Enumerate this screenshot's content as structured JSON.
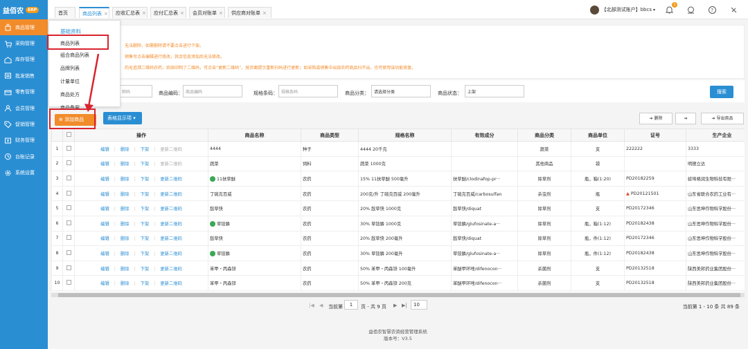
{
  "brand": {
    "name": "益佰农",
    "badge": "ERP"
  },
  "sidebar": {
    "items": [
      {
        "label": "商品管理",
        "icon": "bag-icon",
        "active": true
      },
      {
        "label": "采购管理",
        "icon": "cart-icon"
      },
      {
        "label": "库存管理",
        "icon": "warehouse-icon"
      },
      {
        "label": "批发销售",
        "icon": "wholesale-icon"
      },
      {
        "label": "零售管理",
        "icon": "retail-icon"
      },
      {
        "label": "会员管理",
        "icon": "member-icon"
      },
      {
        "label": "促销管理",
        "icon": "tag-icon"
      },
      {
        "label": "财务管理",
        "icon": "finance-icon"
      },
      {
        "label": "台账记录",
        "icon": "ledger-icon"
      },
      {
        "label": "系统设置",
        "icon": "settings-icon"
      }
    ]
  },
  "tabs": [
    {
      "label": "首页"
    },
    {
      "label": "商品列表",
      "active": true
    },
    {
      "label": "应收汇总表"
    },
    {
      "label": "应付汇总表"
    },
    {
      "label": "会员对账单"
    },
    {
      "label": "供应商对账单"
    }
  ],
  "user": {
    "name": "【北部测试账户】bbcs",
    "notification_count": "1"
  },
  "dropdown": {
    "header": "基础资料",
    "items": [
      "商品列表",
      "组合商品列表",
      "品牌列表",
      "计量单位",
      "商品处方",
      "商品备案"
    ]
  },
  "notices": [
    "无法删除，如需删除请不要点击进行下架。",
    "销售可点击编辑进行修改，其余信息添加后无法修改。",
    "的无追溯二维码农药，后续印制了二维码，可点击“更新二维码”，按页面提示重新扫码进行更新；如采购或销售中出现农药商品扫不出，也可使用该功能修复。"
  ],
  "filters": {
    "name_placeholder": "称码",
    "code_label": "商品编码：",
    "code_placeholder": "商品编码",
    "barcode_label": "规格条码：",
    "barcode_placeholder": "规格条码",
    "category_label": "商品分类：",
    "category_value": "请选择分类",
    "status_label": "商品状态：",
    "status_value": "上架",
    "search": "搜索"
  },
  "toolbar": {
    "add": "添加商品",
    "display": "表格显示项",
    "delete": "删除",
    "export": "导出商品"
  },
  "table": {
    "headers": [
      "操作",
      "商品名称",
      "商品类型",
      "规格名称",
      "有效成分",
      "商品分类",
      "商品单位",
      "证号",
      "生产企业"
    ],
    "actions": {
      "edit": "编辑",
      "delete": "删除",
      "shelf": "下架",
      "qr": "更新二维码"
    },
    "rows": [
      {
        "no": "1",
        "name": "4444",
        "type": "种子",
        "spec": "4444 20千克",
        "ingredient": "",
        "category": "蔬菜",
        "unit": "支",
        "cert": "222222",
        "maker": "3333",
        "qr_active": false
      },
      {
        "no": "2",
        "name": "蔬菜",
        "type": "饲料",
        "spec": "蔬菜 1000克",
        "ingredient": "",
        "category": "其他商品",
        "unit": "袋",
        "cert": "",
        "maker": "明德立达",
        "qr_active": false
      },
      {
        "no": "3",
        "name": "11扶草醚",
        "type": "农药",
        "spec": "15% 11扶草醚 500毫升",
        "ingredient": "扶草醚/clodinafop-pr···",
        "category": "除草剂",
        "unit": "瓶，箱(1:20)",
        "cert": "PD20182259",
        "maker": "蚌埠格润生物科技有限···",
        "qr_active": true,
        "badge": true
      },
      {
        "no": "4",
        "name": "丁硫克百威",
        "type": "农药",
        "spec": "200克/升 丁硫克百威 200毫升",
        "ingredient": "丁硫克百威/carbosulfan",
        "category": "杀虫剂",
        "unit": "瓶",
        "cert": "PD20121501",
        "maker": "山东省联合农药工业有···",
        "qr_active": true,
        "warn": true
      },
      {
        "no": "5",
        "name": "敌草快",
        "type": "农药",
        "spec": "20% 敌草快 1000克",
        "ingredient": "敌草快/diquat",
        "category": "除草剂",
        "unit": "支",
        "cert": "PD20172346",
        "maker": "山东思坤作物科学股份···",
        "qr_active": true
      },
      {
        "no": "6",
        "name": "草铵膦",
        "type": "农药",
        "spec": "30% 草铵膦 1000克",
        "ingredient": "草铵膦/glufosinate-a···",
        "category": "除草剂",
        "unit": "瓶，箱(1:12)",
        "cert": "PD20182438",
        "maker": "山东思坤作物科学股份···",
        "qr_active": true,
        "badge": true
      },
      {
        "no": "7",
        "name": "敌草快",
        "type": "农药",
        "spec": "20% 敌草快 200毫升",
        "ingredient": "敌草快/diquat",
        "category": "除草剂",
        "unit": "瓶，件(1:12)",
        "cert": "PD20172346",
        "maker": "山东思坤作物科学股份···",
        "qr_active": true
      },
      {
        "no": "8",
        "name": "草铵膦",
        "type": "农药",
        "spec": "30% 草铵膦 200毫升",
        "ingredient": "草铵膦/glufosinate-a···",
        "category": "除草剂",
        "unit": "瓶，件(1:12)",
        "cert": "PD20182438",
        "maker": "山东思坤作物科学股份···",
        "qr_active": true,
        "badge": true
      },
      {
        "no": "9",
        "name": "苯甲・丙森锌",
        "type": "农药",
        "spec": "50% 苯甲・丙森锌 100毫升",
        "ingredient": "苯醚甲环唑/difenocon···",
        "category": "杀菌剂",
        "unit": "支",
        "cert": "PD20132518",
        "maker": "陕西美邦药业集团股份···",
        "qr_active": true
      },
      {
        "no": "10",
        "name": "苯甲・丙森锌",
        "type": "农药",
        "spec": "50% 苯甲・丙森锌 200克",
        "ingredient": "苯醚甲环唑/difenocon···",
        "category": "杀菌剂",
        "unit": "支",
        "cert": "PD20132518",
        "maker": "陕西美邦药业集团股份···",
        "qr_active": true
      }
    ]
  },
  "pager": {
    "current_label": "当前第",
    "page": "1",
    "total": "页 - 共 9 页",
    "page_size": "10",
    "summary": "当前第 1 - 10 条  共 89 条"
  },
  "footer": {
    "system": "益佰农智慧农资经营管理系统",
    "version": "版本号：V3.5"
  },
  "colors": {
    "primary": "#2a8ed3",
    "accent": "#f28b2a",
    "highlight": "#d9232e"
  }
}
